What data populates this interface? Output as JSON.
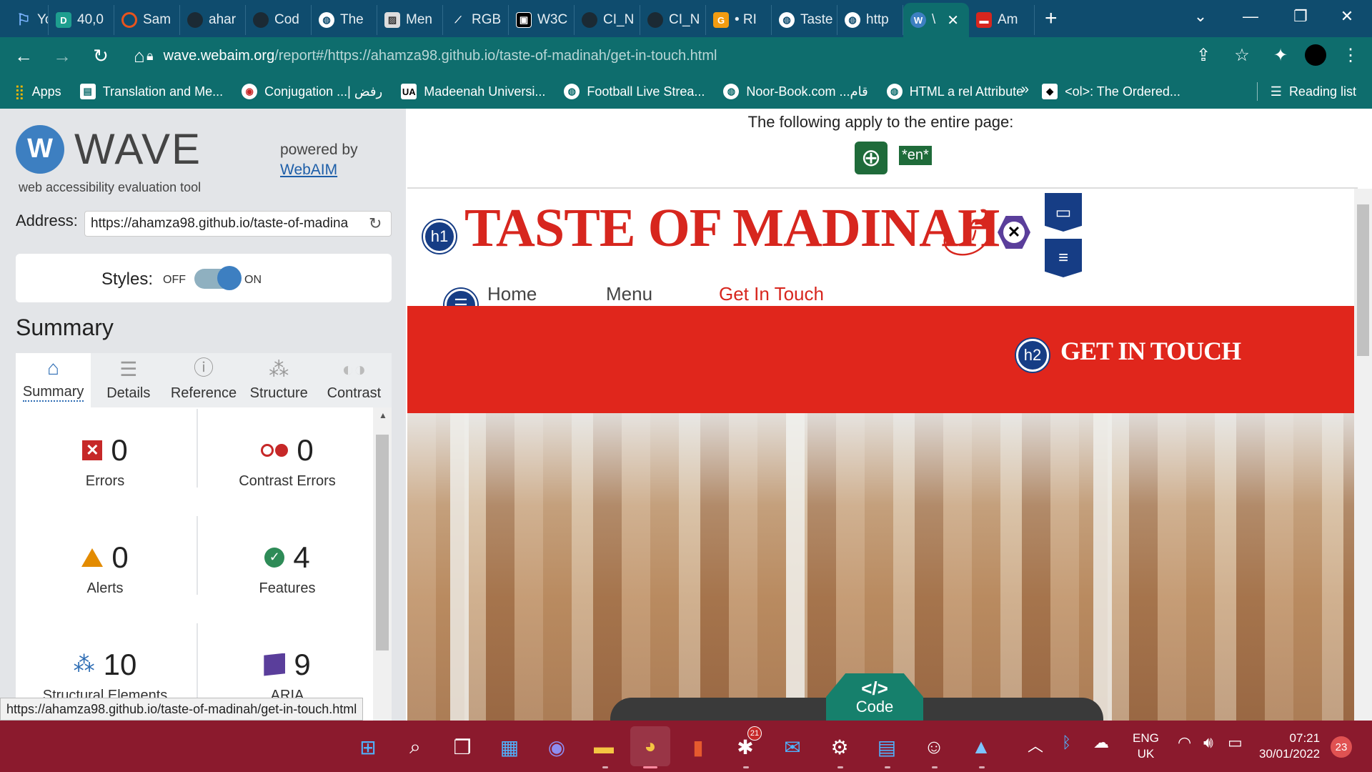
{
  "browser": {
    "tabs": [
      {
        "label": "Yout",
        "icon": "flag-icon",
        "color": "#1a73e8"
      },
      {
        "label": "40,0",
        "icon": "D",
        "color": "#1e9e8f"
      },
      {
        "label": "Sam",
        "icon": "circle-icon",
        "color": "#e8541e"
      },
      {
        "label": "ahar",
        "icon": "github-icon",
        "color": "#222222"
      },
      {
        "label": "Cod",
        "icon": "github-icon",
        "color": "#222222"
      },
      {
        "label": "The",
        "icon": "globe-icon",
        "color": "#ffffff"
      },
      {
        "label": "Men",
        "icon": "image-icon",
        "color": "#dddddd"
      },
      {
        "label": "RGB",
        "icon": "dropper-icon",
        "color": "#222222"
      },
      {
        "label": "W3C",
        "icon": "w3c-icon",
        "color": "#000000"
      },
      {
        "label": "CI_N",
        "icon": "github-icon",
        "color": "#222222"
      },
      {
        "label": "CI_N",
        "icon": "github-icon",
        "color": "#222222"
      },
      {
        "label": "• RI",
        "icon": "g-icon",
        "color": "#f29c11"
      },
      {
        "label": "Taste",
        "icon": "globe-icon",
        "color": "#ffffff"
      },
      {
        "label": "http",
        "icon": "globe-icon",
        "color": "#ffffff"
      },
      {
        "label": "\\",
        "icon": "wave-icon",
        "color": "#3d7fc1",
        "active": true
      },
      {
        "label": "Am",
        "icon": "doc-icon",
        "color": "#d7261e"
      }
    ],
    "new_tab": "+",
    "window_controls": {
      "dropdown": "⌄",
      "minimize": "—",
      "restore": "❐",
      "close": "✕"
    },
    "address": {
      "host": "wave.webaim.org",
      "path": "/report#/https://ahamza98.github.io/taste-of-madinah/get-in-touch.html"
    },
    "bookmarks": [
      {
        "label": "Apps",
        "icon": "apps-icon"
      },
      {
        "label": "Translation and Me...",
        "icon": "book-icon"
      },
      {
        "label": "Conjugation ...| رفض",
        "icon": "conjugation-icon"
      },
      {
        "label": "Madeenah Universi...",
        "icon": "UA"
      },
      {
        "label": "Football Live Strea...",
        "icon": "globe-icon"
      },
      {
        "label": "Noor-Book.com ...قام",
        "icon": "globe-icon"
      },
      {
        "label": "HTML a rel Attribute",
        "icon": "globe-icon"
      },
      {
        "label": "<ol>: The Ordered...",
        "icon": "mdn-icon"
      }
    ],
    "bookmarks_more": "»",
    "reading_list": "Reading list",
    "status_url": "https://ahamza98.github.io/taste-of-madinah/get-in-touch.html"
  },
  "wave": {
    "logo_text": "WAVE",
    "tagline": "web accessibility evaluation tool",
    "powered_by": "powered by",
    "webaim": "WebAIM",
    "address_label": "Address:",
    "address_value": "https://ahamza98.github.io/taste-of-madina",
    "styles_label": "Styles:",
    "styles_off": "OFF",
    "styles_on": "ON",
    "summary_title": "Summary",
    "tabs": [
      {
        "label": "Summary",
        "icon": "home-icon",
        "active": true
      },
      {
        "label": "Details",
        "icon": "list-icon"
      },
      {
        "label": "Reference",
        "icon": "info-icon"
      },
      {
        "label": "Structure",
        "icon": "structure-icon"
      },
      {
        "label": "Contrast",
        "icon": "contrast-icon"
      }
    ],
    "summary": {
      "errors": {
        "count": "0",
        "label": "Errors"
      },
      "contrast_errors": {
        "count": "0",
        "label": "Contrast Errors"
      },
      "alerts": {
        "count": "0",
        "label": "Alerts"
      },
      "features": {
        "count": "4",
        "label": "Features"
      },
      "structural": {
        "count": "10",
        "label": "Structural Elements"
      },
      "aria": {
        "count": "9",
        "label": "ARIA"
      }
    }
  },
  "preview": {
    "apply_text": "The following apply to the entire page:",
    "lang_badge": "*en*",
    "site_title": "TASTE OF MADINAH",
    "h1_badge": "h1",
    "h2_badge": "h2",
    "nav": [
      {
        "label": "Home"
      },
      {
        "label": "Menu"
      },
      {
        "label": "Get In Touch",
        "current": true
      }
    ],
    "section_title": "GET IN TOUCH",
    "code_symbol": "</>",
    "code_label": "Code",
    "colors": {
      "brand_red": "#d7261e",
      "band_red": "#e0261c",
      "badge_blue": "#163d85"
    }
  },
  "taskbar": {
    "apps": [
      "windows-start-icon",
      "search-icon",
      "task-view-icon",
      "widgets-icon",
      "teams-chat-icon",
      "file-explorer-icon",
      "chrome-icon",
      "office-icon",
      "slack-icon",
      "mail-icon",
      "settings-icon",
      "notepad-icon",
      "emoji-icon",
      "photos-icon"
    ],
    "slack_badge": "21",
    "lang_line1": "ENG",
    "lang_line2": "UK",
    "time": "07:21",
    "date": "30/01/2022",
    "notifications": "23"
  }
}
